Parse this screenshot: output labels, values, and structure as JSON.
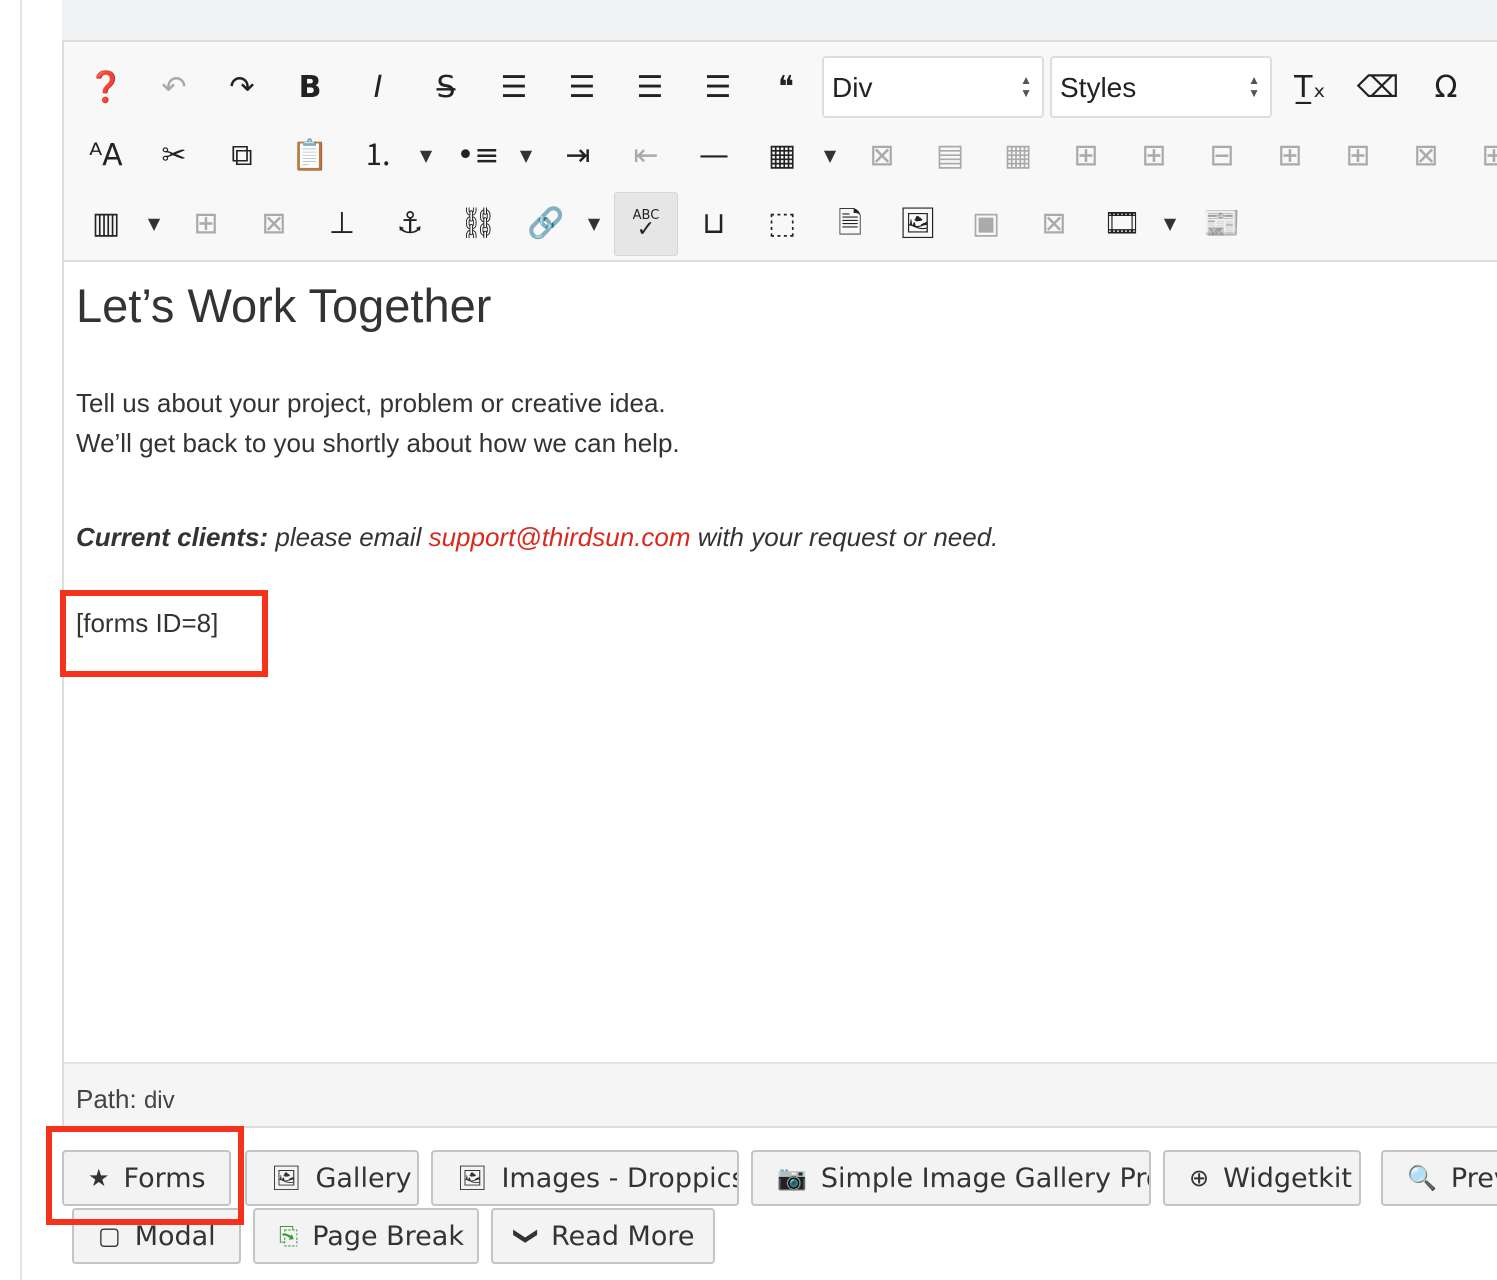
{
  "toolbar": {
    "row1": [
      {
        "icon": "help-icon"
      },
      {
        "icon": "undo-icon",
        "disabled": true
      },
      {
        "icon": "redo-icon"
      },
      {
        "icon": "bold-icon"
      },
      {
        "icon": "italic-icon"
      },
      {
        "icon": "strikethrough-icon"
      },
      {
        "icon": "align-justify-icon"
      },
      {
        "icon": "align-center-icon"
      },
      {
        "icon": "align-left-icon"
      },
      {
        "icon": "align-right-icon"
      },
      {
        "icon": "blockquote-icon"
      }
    ],
    "format_select": "Div",
    "styles_select": "Styles",
    "row1_end": [
      {
        "icon": "remove-format-icon"
      },
      {
        "icon": "cleanup-icon"
      },
      {
        "icon": "special-char-icon"
      }
    ],
    "row2": [
      {
        "icon": "font-size-icon"
      },
      {
        "icon": "cut-icon"
      },
      {
        "icon": "copy-icon"
      },
      {
        "icon": "paste-text-icon"
      },
      {
        "icon": "numbered-list-icon"
      },
      {
        "icon": "dropdown-arrow-icon"
      },
      {
        "icon": "bullet-list-icon"
      },
      {
        "icon": "dropdown-arrow-icon"
      },
      {
        "icon": "indent-icon"
      },
      {
        "icon": "outdent-icon",
        "disabled": true
      },
      {
        "icon": "horizontal-rule-icon"
      },
      {
        "icon": "table-icon"
      },
      {
        "icon": "dropdown-arrow-icon"
      },
      {
        "icon": "delete-table-icon",
        "disabled": true
      },
      {
        "icon": "table-row-props-icon",
        "disabled": true
      },
      {
        "icon": "table-cell-props-icon",
        "disabled": true
      },
      {
        "icon": "insert-row-before-icon",
        "disabled": true
      },
      {
        "icon": "insert-row-after-icon",
        "disabled": true
      },
      {
        "icon": "delete-row-icon",
        "disabled": true
      },
      {
        "icon": "insert-col-before-icon",
        "disabled": true
      },
      {
        "icon": "insert-col-after-icon",
        "disabled": true
      },
      {
        "icon": "delete-col-icon",
        "disabled": true
      },
      {
        "icon": "split-cells-icon",
        "disabled": true
      }
    ],
    "row3": [
      {
        "icon": "columns-icon"
      },
      {
        "icon": "dropdown-arrow-icon"
      },
      {
        "icon": "add-column-icon",
        "disabled": true
      },
      {
        "icon": "delete-column-icon",
        "disabled": true
      },
      {
        "icon": "insert-icon"
      },
      {
        "icon": "anchor-icon"
      },
      {
        "icon": "unlink-icon"
      },
      {
        "icon": "link-icon"
      },
      {
        "icon": "dropdown-arrow-icon"
      },
      {
        "icon": "spellcheck-icon",
        "active": true
      },
      {
        "icon": "nonbreaking-icon"
      },
      {
        "icon": "visual-blocks-icon"
      },
      {
        "icon": "document-icon"
      },
      {
        "icon": "image-icon"
      },
      {
        "icon": "image-manager-icon",
        "disabled": true
      },
      {
        "icon": "image-delete-icon",
        "disabled": true
      },
      {
        "icon": "media-icon"
      },
      {
        "icon": "dropdown-arrow-icon"
      },
      {
        "icon": "template-icon"
      }
    ]
  },
  "content": {
    "heading": "Let’s Work Together",
    "line1": "Tell us about your project, problem or creative idea.",
    "line2": "We’ll get back to you shortly about how we can help.",
    "clients_label": "Current clients:",
    "clients_pre": " please email ",
    "email": "support@thirdsun.com",
    "clients_post": " with your request or need.",
    "shortcode": "[forms ID=8]"
  },
  "pathbar": {
    "label": "Path:",
    "value": "div"
  },
  "buttons": [
    {
      "label": "Forms",
      "icon": "star-icon"
    },
    {
      "label": "Gallery",
      "icon": "image-icon"
    },
    {
      "label": "Images - Droppics",
      "icon": "image-icon"
    },
    {
      "label": "Simple Image Gallery Pro",
      "icon": "camera-icon"
    },
    {
      "label": "Widgetkit",
      "icon": "plus-circle-icon"
    },
    {
      "label": "Preview",
      "icon": "search-icon"
    },
    {
      "label": "Modal",
      "icon": "modal-icon"
    },
    {
      "label": "Page Break",
      "icon": "page-break-icon"
    },
    {
      "label": "Read More",
      "icon": "chevron-down-icon"
    }
  ],
  "colors": {
    "link": "#d9291c",
    "highlight": "#f5321c"
  }
}
